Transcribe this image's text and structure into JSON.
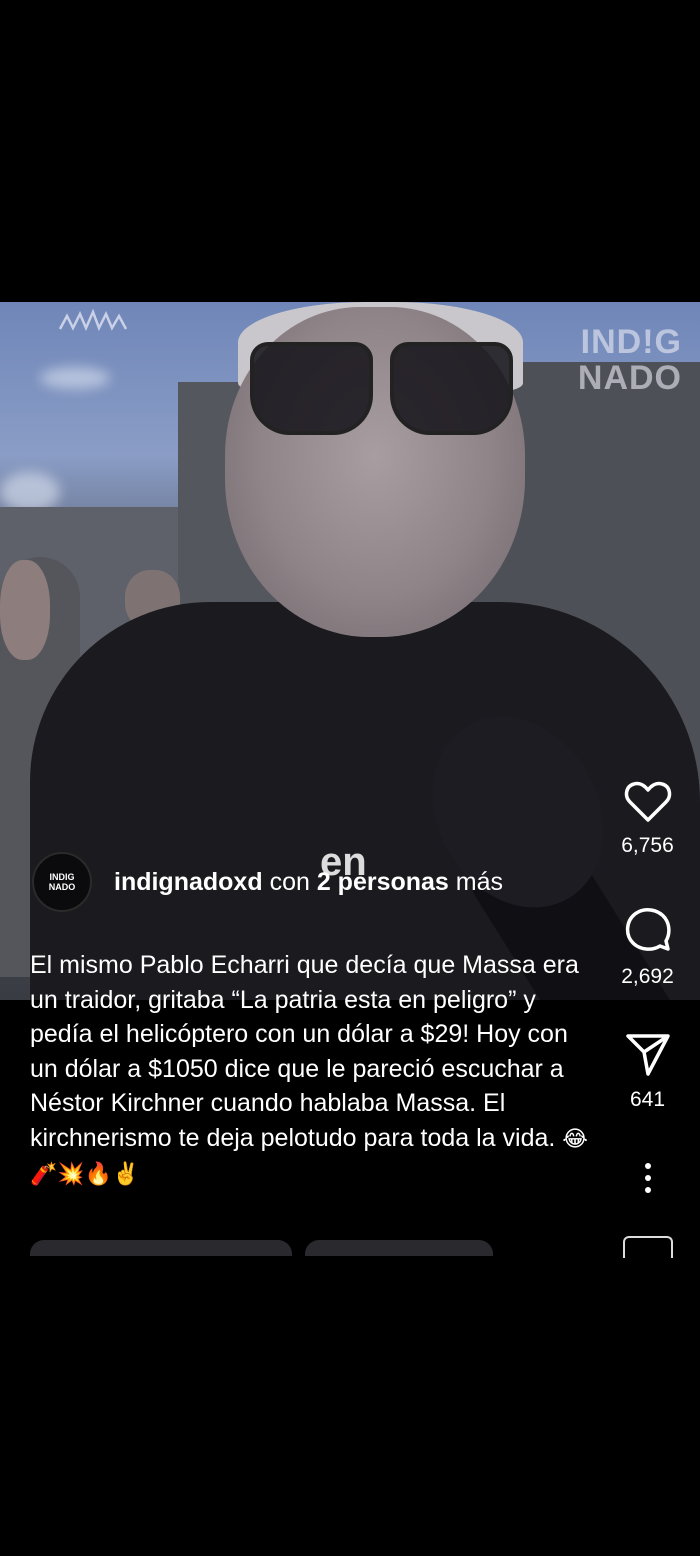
{
  "video": {
    "watermark_line1": "IND!G",
    "watermark_line2": "NADO",
    "subtitle_fragment": "en"
  },
  "author": {
    "avatar_line1": "INDIG",
    "avatar_line2": "NADO",
    "username": "indignadoxd",
    "with_text": "con",
    "collab_count": "2 personas",
    "more_text": "más"
  },
  "caption": {
    "text": "El mismo Pablo Echarri que decía que Massa era un traidor, gritaba “La patria esta en peligro” y pedía el helicóptero con un dólar a $29! Hoy con un dólar a $1050 dice que le pareció escuchar a Néstor Kirchner cuando hablaba Massa. El kirchnerismo te deja pelotudo para toda la vida.",
    "emojis": "😂🧨💥🔥✌️"
  },
  "actions": {
    "like_icon": "heart-icon",
    "likes": "6,756",
    "comment_icon": "comment-icon",
    "comments": "2,692",
    "share_icon": "share-icon",
    "shares": "641",
    "more_icon": "more-vertical-icon"
  }
}
